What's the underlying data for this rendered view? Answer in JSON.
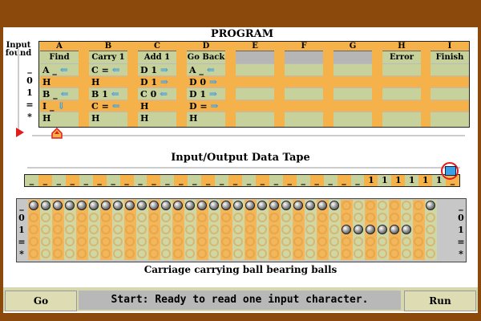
{
  "program": {
    "title": "PROGRAM",
    "input_found_label": "Input found",
    "row_symbols": [
      "_",
      "0",
      "1",
      "=",
      "*"
    ],
    "columns": [
      {
        "letter": "A",
        "name": "Find",
        "rows": [
          "A _ ⇐",
          "H",
          "B _ ⇐",
          "I _ ⇓",
          "H"
        ]
      },
      {
        "letter": "B",
        "name": "Carry 1",
        "rows": [
          "C = ⇐",
          "H",
          "B 1 ⇐",
          "C = ⇐",
          "H"
        ]
      },
      {
        "letter": "C",
        "name": "Add 1",
        "rows": [
          "D 1 ⇒",
          "D 1 ⇒",
          "C 0 ⇐",
          "H",
          "H"
        ]
      },
      {
        "letter": "D",
        "name": "Go Back",
        "rows": [
          "A _ ⇐",
          "D 0 ⇒",
          "D 1 ⇒",
          "D = ⇒",
          "H"
        ]
      },
      {
        "letter": "E",
        "name": "",
        "rows": [
          "",
          "",
          "",
          "",
          ""
        ]
      },
      {
        "letter": "F",
        "name": "",
        "rows": [
          "",
          "",
          "",
          "",
          ""
        ]
      },
      {
        "letter": "G",
        "name": "",
        "rows": [
          "",
          "",
          "",
          "",
          ""
        ]
      },
      {
        "letter": "H",
        "name": "Error",
        "rows": [
          "",
          "",
          "",
          "",
          ""
        ]
      },
      {
        "letter": "I",
        "name": "Finish",
        "rows": [
          "",
          "",
          "",
          "",
          ""
        ]
      }
    ]
  },
  "tape": {
    "title": "Input/Output Data Tape",
    "cells": [
      "_",
      "_",
      "_",
      "_",
      "_",
      "_",
      "_",
      "_",
      "_",
      "_",
      "_",
      "_",
      "_",
      "_",
      "_",
      "_",
      "_",
      "_",
      "_",
      "_",
      "_",
      "_",
      "_",
      "_",
      "_",
      "1",
      "1",
      "1",
      "1",
      "1",
      "1",
      "_"
    ]
  },
  "carriage": {
    "caption": "Carriage carrying ball bearing balls",
    "row_labels": [
      "_",
      "0",
      "1",
      "=",
      "*"
    ]
  },
  "controls": {
    "go_label": "Go",
    "run_label": "Run",
    "status": "Start: Ready to read one input character."
  },
  "colors": {
    "frame": "#8b4a0c",
    "orange": "#f6b24a",
    "green": "#c7d19b",
    "accent_blue": "#3aa0e8",
    "red": "#e21c1c"
  }
}
